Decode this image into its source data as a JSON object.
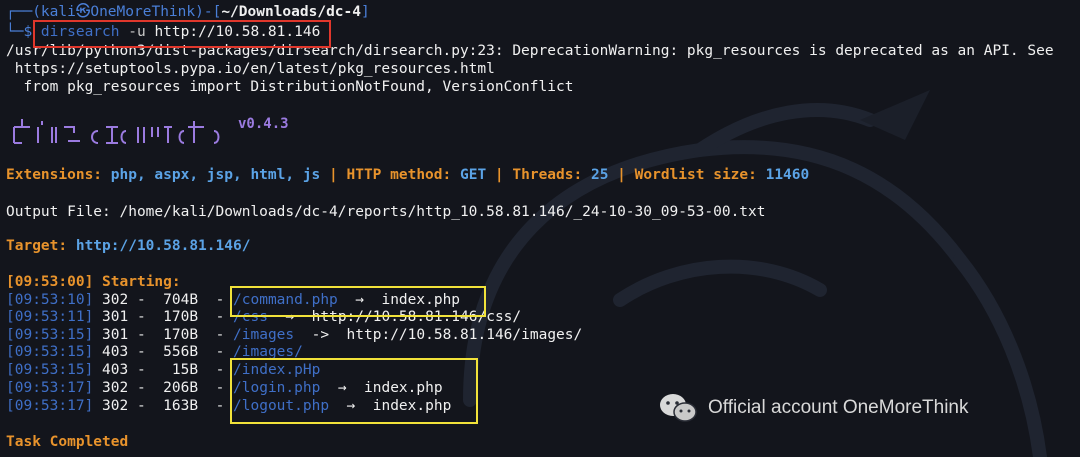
{
  "prompt": {
    "user_host": "(kali㉿OneMoreThink)",
    "path": "~/Downloads/dc-4",
    "command": "dirsearch",
    "flag": "-u",
    "arg": "http://10.58.81.146"
  },
  "warnings": [
    "/usr/lib/python3/dist-packages/dirsearch/dirsearch.py:23: DeprecationWarning: pkg_resources is deprecated as an API. See",
    " https://setuptools.pypa.io/en/latest/pkg_resources.html",
    "  from pkg_resources import DistributionNotFound, VersionConflict"
  ],
  "banner": {
    "version": "v0.4.3"
  },
  "config": {
    "ext_label": "Extensions:",
    "ext_value": "php, aspx, jsp, html, js",
    "method_label": "HTTP method:",
    "method_value": "GET",
    "threads_label": "Threads:",
    "threads_value": "25",
    "wordlist_label": "Wordlist size:",
    "wordlist_value": "11460"
  },
  "output_file": "Output File: /home/kali/Downloads/dc-4/reports/http_10.58.81.146/_24-10-30_09-53-00.txt",
  "target": {
    "label": "Target:",
    "value": "http://10.58.81.146/"
  },
  "start": {
    "time": "[09:53:00]",
    "text": "Starting:"
  },
  "results": [
    {
      "time": "[09:53:10]",
      "code": "302",
      "size": " 704B",
      "path": "/command.php",
      "arrow": "→",
      "redirect": "index.php"
    },
    {
      "time": "[09:53:11]",
      "code": "301",
      "size": " 170B",
      "path": "/css",
      "arrow": "→",
      "redirect": "http://10.58.81.146/css/"
    },
    {
      "time": "[09:53:15]",
      "code": "301",
      "size": " 170B",
      "path": "/images",
      "arrow": "->",
      "redirect": "http://10.58.81.146/images/"
    },
    {
      "time": "[09:53:15]",
      "code": "403",
      "size": " 556B",
      "path": "/images/",
      "arrow": "",
      "redirect": ""
    },
    {
      "time": "[09:53:15]",
      "code": "403",
      "size": "  15B",
      "path": "/index.pHp",
      "arrow": "",
      "redirect": ""
    },
    {
      "time": "[09:53:17]",
      "code": "302",
      "size": " 206B",
      "path": "/login.php",
      "arrow": "→",
      "redirect": "index.php"
    },
    {
      "time": "[09:53:17]",
      "code": "302",
      "size": " 163B",
      "path": "/logout.php",
      "arrow": "→",
      "redirect": "index.php"
    }
  ],
  "completed": "Task Completed",
  "watermark": "Official account OneMoreThink",
  "colors": {
    "background": "#13151c",
    "prompt_blue": "#4a7fd8",
    "highlight_orange": "#e8932c",
    "value_blue": "#5ba3e6",
    "box_red": "#e0372c",
    "box_yellow": "#f1e23a"
  }
}
